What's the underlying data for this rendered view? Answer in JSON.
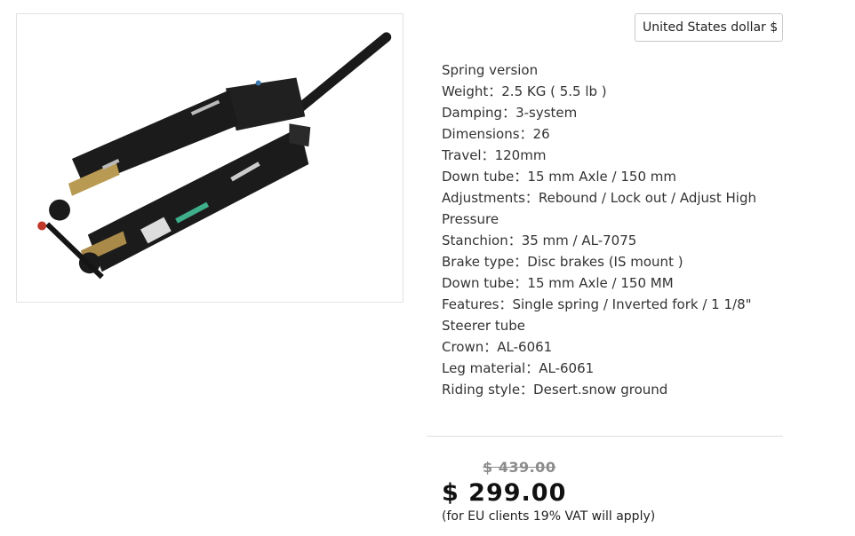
{
  "currency_selector": {
    "value": "United States dollar $"
  },
  "product_image": {
    "icon": "suspension-fork-image"
  },
  "specs": [
    "Spring version",
    "Weight：2.5 KG ( 5.5 lb )",
    "Damping：3-system",
    "Dimensions：26",
    "Travel：120mm",
    "Down tube：15 mm Axle / 150 mm",
    "Adjustments：Rebound / Lock out / Adjust High Pressure",
    "Stanchion：35 mm / AL-7075",
    "Brake type：Disc brakes (IS mount )",
    "Down tube：15 mm Axle / 150 MM",
    "Features：Single spring / Inverted fork / 1 1/8\" Steerer tube",
    "Crown：AL-6061",
    "Leg material：AL-6061",
    "Riding style：Desert.snow ground"
  ],
  "pricing": {
    "old_price": "$ 439.00",
    "new_price": "$ 299.00",
    "vat_note": "(for EU clients 19% VAT will apply)"
  }
}
